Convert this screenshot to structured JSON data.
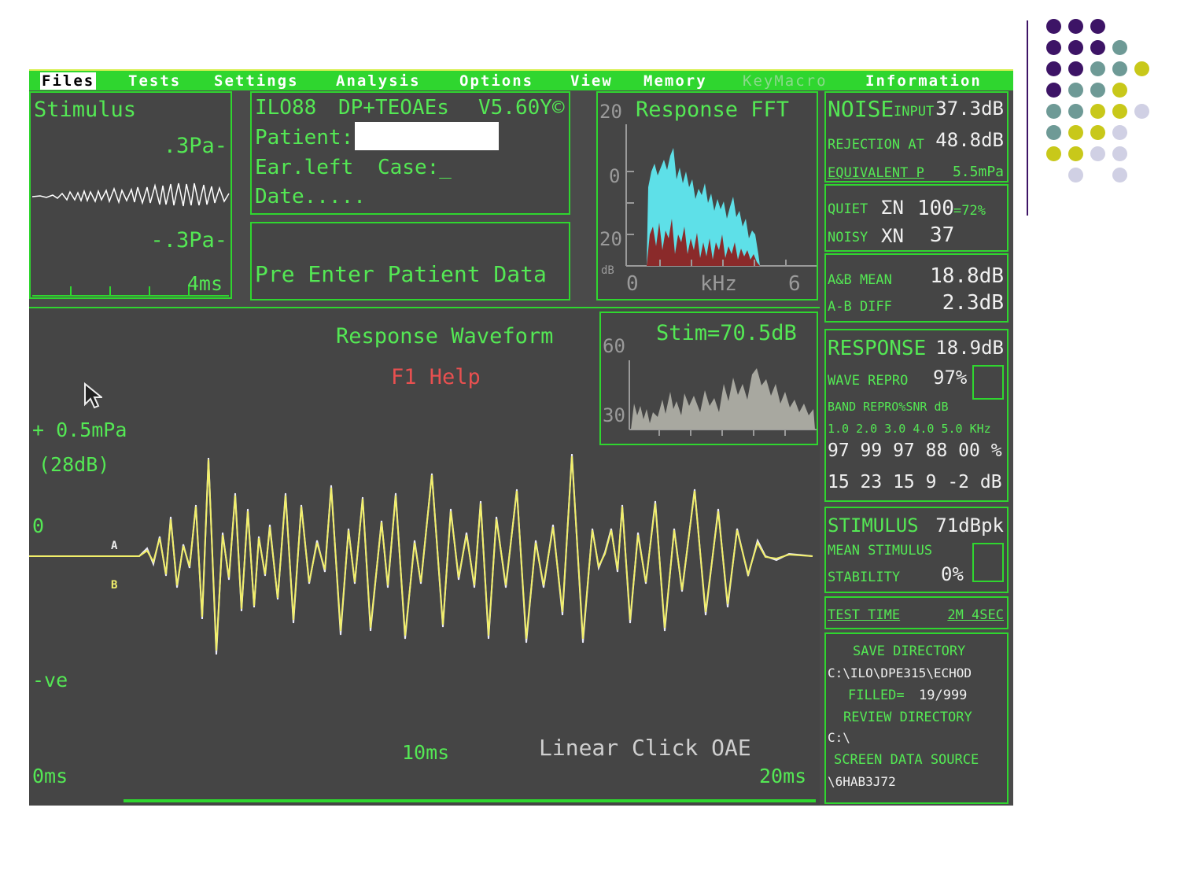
{
  "menu": [
    "Files",
    "Tests",
    "Settings",
    "Analysis",
    "Options",
    "View",
    "Memory",
    "KeyMacro",
    "Information"
  ],
  "stimulus": {
    "title": "Stimulus",
    "top": ".3Pa-",
    "bottom": "-.3Pa-",
    "time": "4ms"
  },
  "header": {
    "device": "ILO88",
    "mode": "DP+TEOAEs",
    "version": "V5.60Y©",
    "patient_label": "Patient:",
    "ear": "Ear.left",
    "case": "Case:_",
    "date": "Date....."
  },
  "prompt": "Pre Enter Patient Data",
  "fft": {
    "title": "Response FFT",
    "y_top": "20",
    "y_zero": "0",
    "y_bot": "20",
    "unit": "dB",
    "x_start": "0",
    "x_unit": "kHz",
    "x_end": "6"
  },
  "stats": {
    "noise_label": "NOISE",
    "input_label": "INPUT",
    "input_val": "37.3dB",
    "rejection_label": "REJECTION AT",
    "rejection_val": "48.8dB",
    "equiv_label": "EQUIVALENT P",
    "equiv_val": "5.5mPa",
    "quiet_label": "QUIET",
    "quiet_sym": "ΣN",
    "quiet_val": "100",
    "quiet_pct": "=72%",
    "noisy_label": "NOISY",
    "noisy_sym": "XN",
    "noisy_val": "37",
    "ab_mean_label": "A&B MEAN",
    "ab_mean_val": "18.8dB",
    "ab_diff_label": "A-B DIFF",
    "ab_diff_val": "2.3dB",
    "response_label": "RESPONSE",
    "response_val": "18.9dB",
    "wave_repro_label": "WAVE REPRO",
    "wave_repro_val": "97%",
    "band_label": "BAND REPRO%SNR dB",
    "bands": "1.0 2.0 3.0 4.0 5.0 KHz",
    "repro_row": "97 99 97 88 00 %",
    "snr_row": "15 23 15  9 -2 dB",
    "stimulus_label": "STIMULUS",
    "stimulus_val": "71dBpk",
    "mean_stim_label": "MEAN STIMULUS",
    "stability_label": "STABILITY",
    "stability_val": "0%",
    "test_time_label": "TEST TIME",
    "test_time_val": "2M  4SEC",
    "save_dir_label": "SAVE DIRECTORY",
    "save_dir": "C:\\ILO\\DPE315\\ECHOD",
    "filled_label": "FILLED=",
    "filled_val": "19/999",
    "review_label": "REVIEW DIRECTORY",
    "review_dir": "C:\\",
    "source_label": "SCREEN DATA SOURCE",
    "source": "\\6HAB3J72"
  },
  "waveform": {
    "title": "Response Waveform",
    "help": "F1 Help",
    "scale": "+ 0.5mPa",
    "scale_db": "(28dB)",
    "zero": "0",
    "neg": "-ve",
    "label_a": "A",
    "label_b": "B",
    "t0": "0ms",
    "t_mid": "10ms",
    "t_end": "20ms",
    "mode": "Linear Click OAE"
  },
  "stim_spectrum": {
    "title": "Stim=70.5dB",
    "y_top": "60",
    "y_bot": "30"
  },
  "colors": {
    "screen": "#4a4a4a",
    "green": "#2fd62f",
    "text_green": "#54e854",
    "wave_yellow": "#f2ef6a",
    "wave_white": "#e8e8f8",
    "fft_cyan": "#5ee0e8",
    "fft_red": "#8a2a2a",
    "spectrum_gray": "#a8a8a0",
    "help_red": "#e85050",
    "purple": "#3d1466",
    "teal": "#6e9a96",
    "olive": "#c8c81a",
    "lavender": "#d0d0e4"
  }
}
